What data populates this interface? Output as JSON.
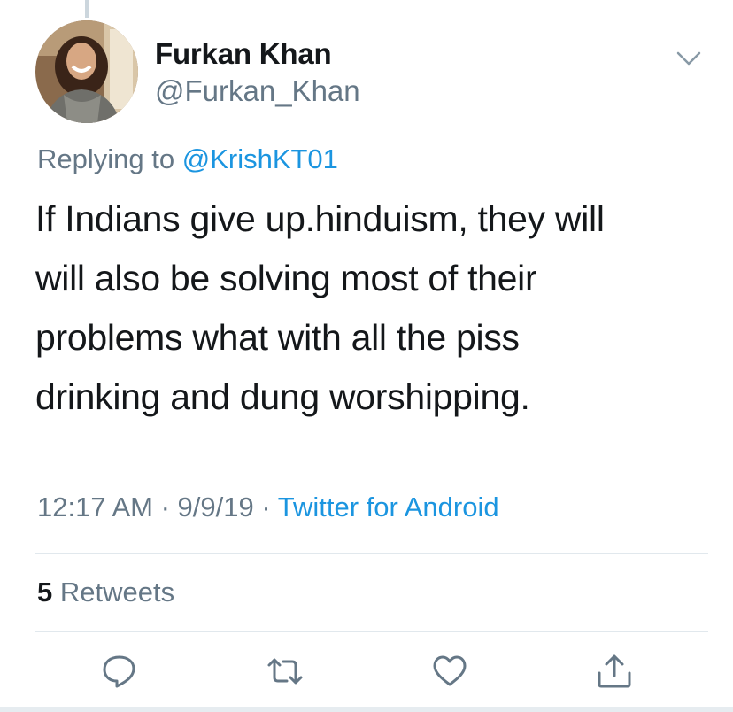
{
  "author": {
    "name": "Furkan Khan",
    "handle": "@Furkan_Khan"
  },
  "reply": {
    "prefix": "Replying to",
    "mention": "@KrishKT01"
  },
  "tweet": {
    "lines": [
      "If Indians give up.hinduism, they will",
      "will also be solving most of their",
      "problems what with all the piss",
      "drinking and dung worshipping."
    ]
  },
  "meta": {
    "time": "12:17 AM",
    "separator": " · ",
    "date": "9/9/19",
    "source": "Twitter for Android"
  },
  "stats": {
    "retweet_count": "5",
    "retweet_label": "Retweets"
  },
  "icons": {
    "menu": "chevron-down-icon",
    "reply": "reply-icon",
    "retweet": "retweet-icon",
    "like": "heart-icon",
    "share": "share-icon"
  },
  "colors": {
    "link": "#1b95e0",
    "secondary_text": "#657786",
    "primary_text": "#14171a",
    "icon": "#657786",
    "divider": "#e1e8ed"
  }
}
